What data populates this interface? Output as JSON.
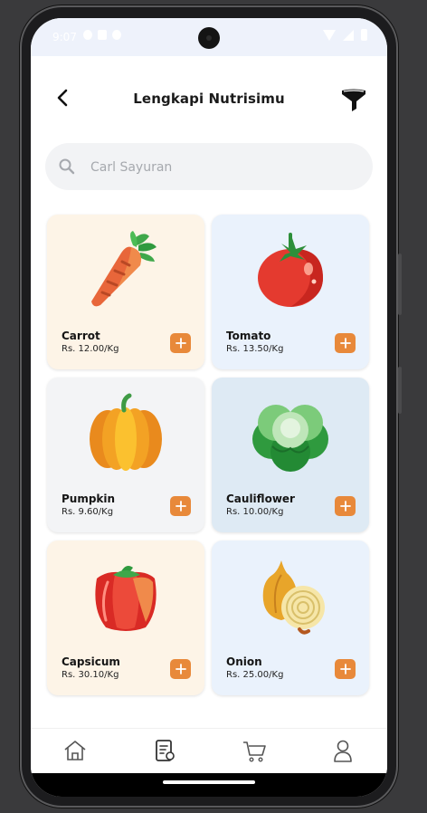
{
  "status_bar": {
    "time": "9:07"
  },
  "header": {
    "title": "Lengkapi Nutrisimu",
    "back_icon": "arrow-left-icon",
    "filter_icon": "funnel-icon"
  },
  "search": {
    "placeholder": "Carl Sayuran",
    "value": ""
  },
  "products": [
    {
      "name": "Carrot",
      "price": "Rs. 12.00/Kg",
      "icon": "carrot-icon",
      "bg": "#fdf4e7"
    },
    {
      "name": "Tomato",
      "price": "Rs. 13.50/Kg",
      "icon": "tomato-icon",
      "bg": "#eaf2fc"
    },
    {
      "name": "Pumpkin",
      "price": "Rs. 9.60/Kg",
      "icon": "pumpkin-icon",
      "bg": "#f3f4f6"
    },
    {
      "name": "Cauliflower",
      "price": "Rs. 10.00/Kg",
      "icon": "cabbage-icon",
      "bg": "#deeaf4"
    },
    {
      "name": "Capsicum",
      "price": "Rs. 30.10/Kg",
      "icon": "capsicum-icon",
      "bg": "#fdf4e7"
    },
    {
      "name": "Onion",
      "price": "Rs. 25.00/Kg",
      "icon": "onion-icon",
      "bg": "#eaf2fc"
    }
  ],
  "bottom_nav": {
    "items": [
      {
        "icon": "home-icon"
      },
      {
        "icon": "receipt-icon"
      },
      {
        "icon": "cart-icon"
      },
      {
        "icon": "user-icon"
      }
    ]
  },
  "colors": {
    "accent": "#e8893a",
    "text": "#151515",
    "search_bg": "#f2f3f5"
  }
}
